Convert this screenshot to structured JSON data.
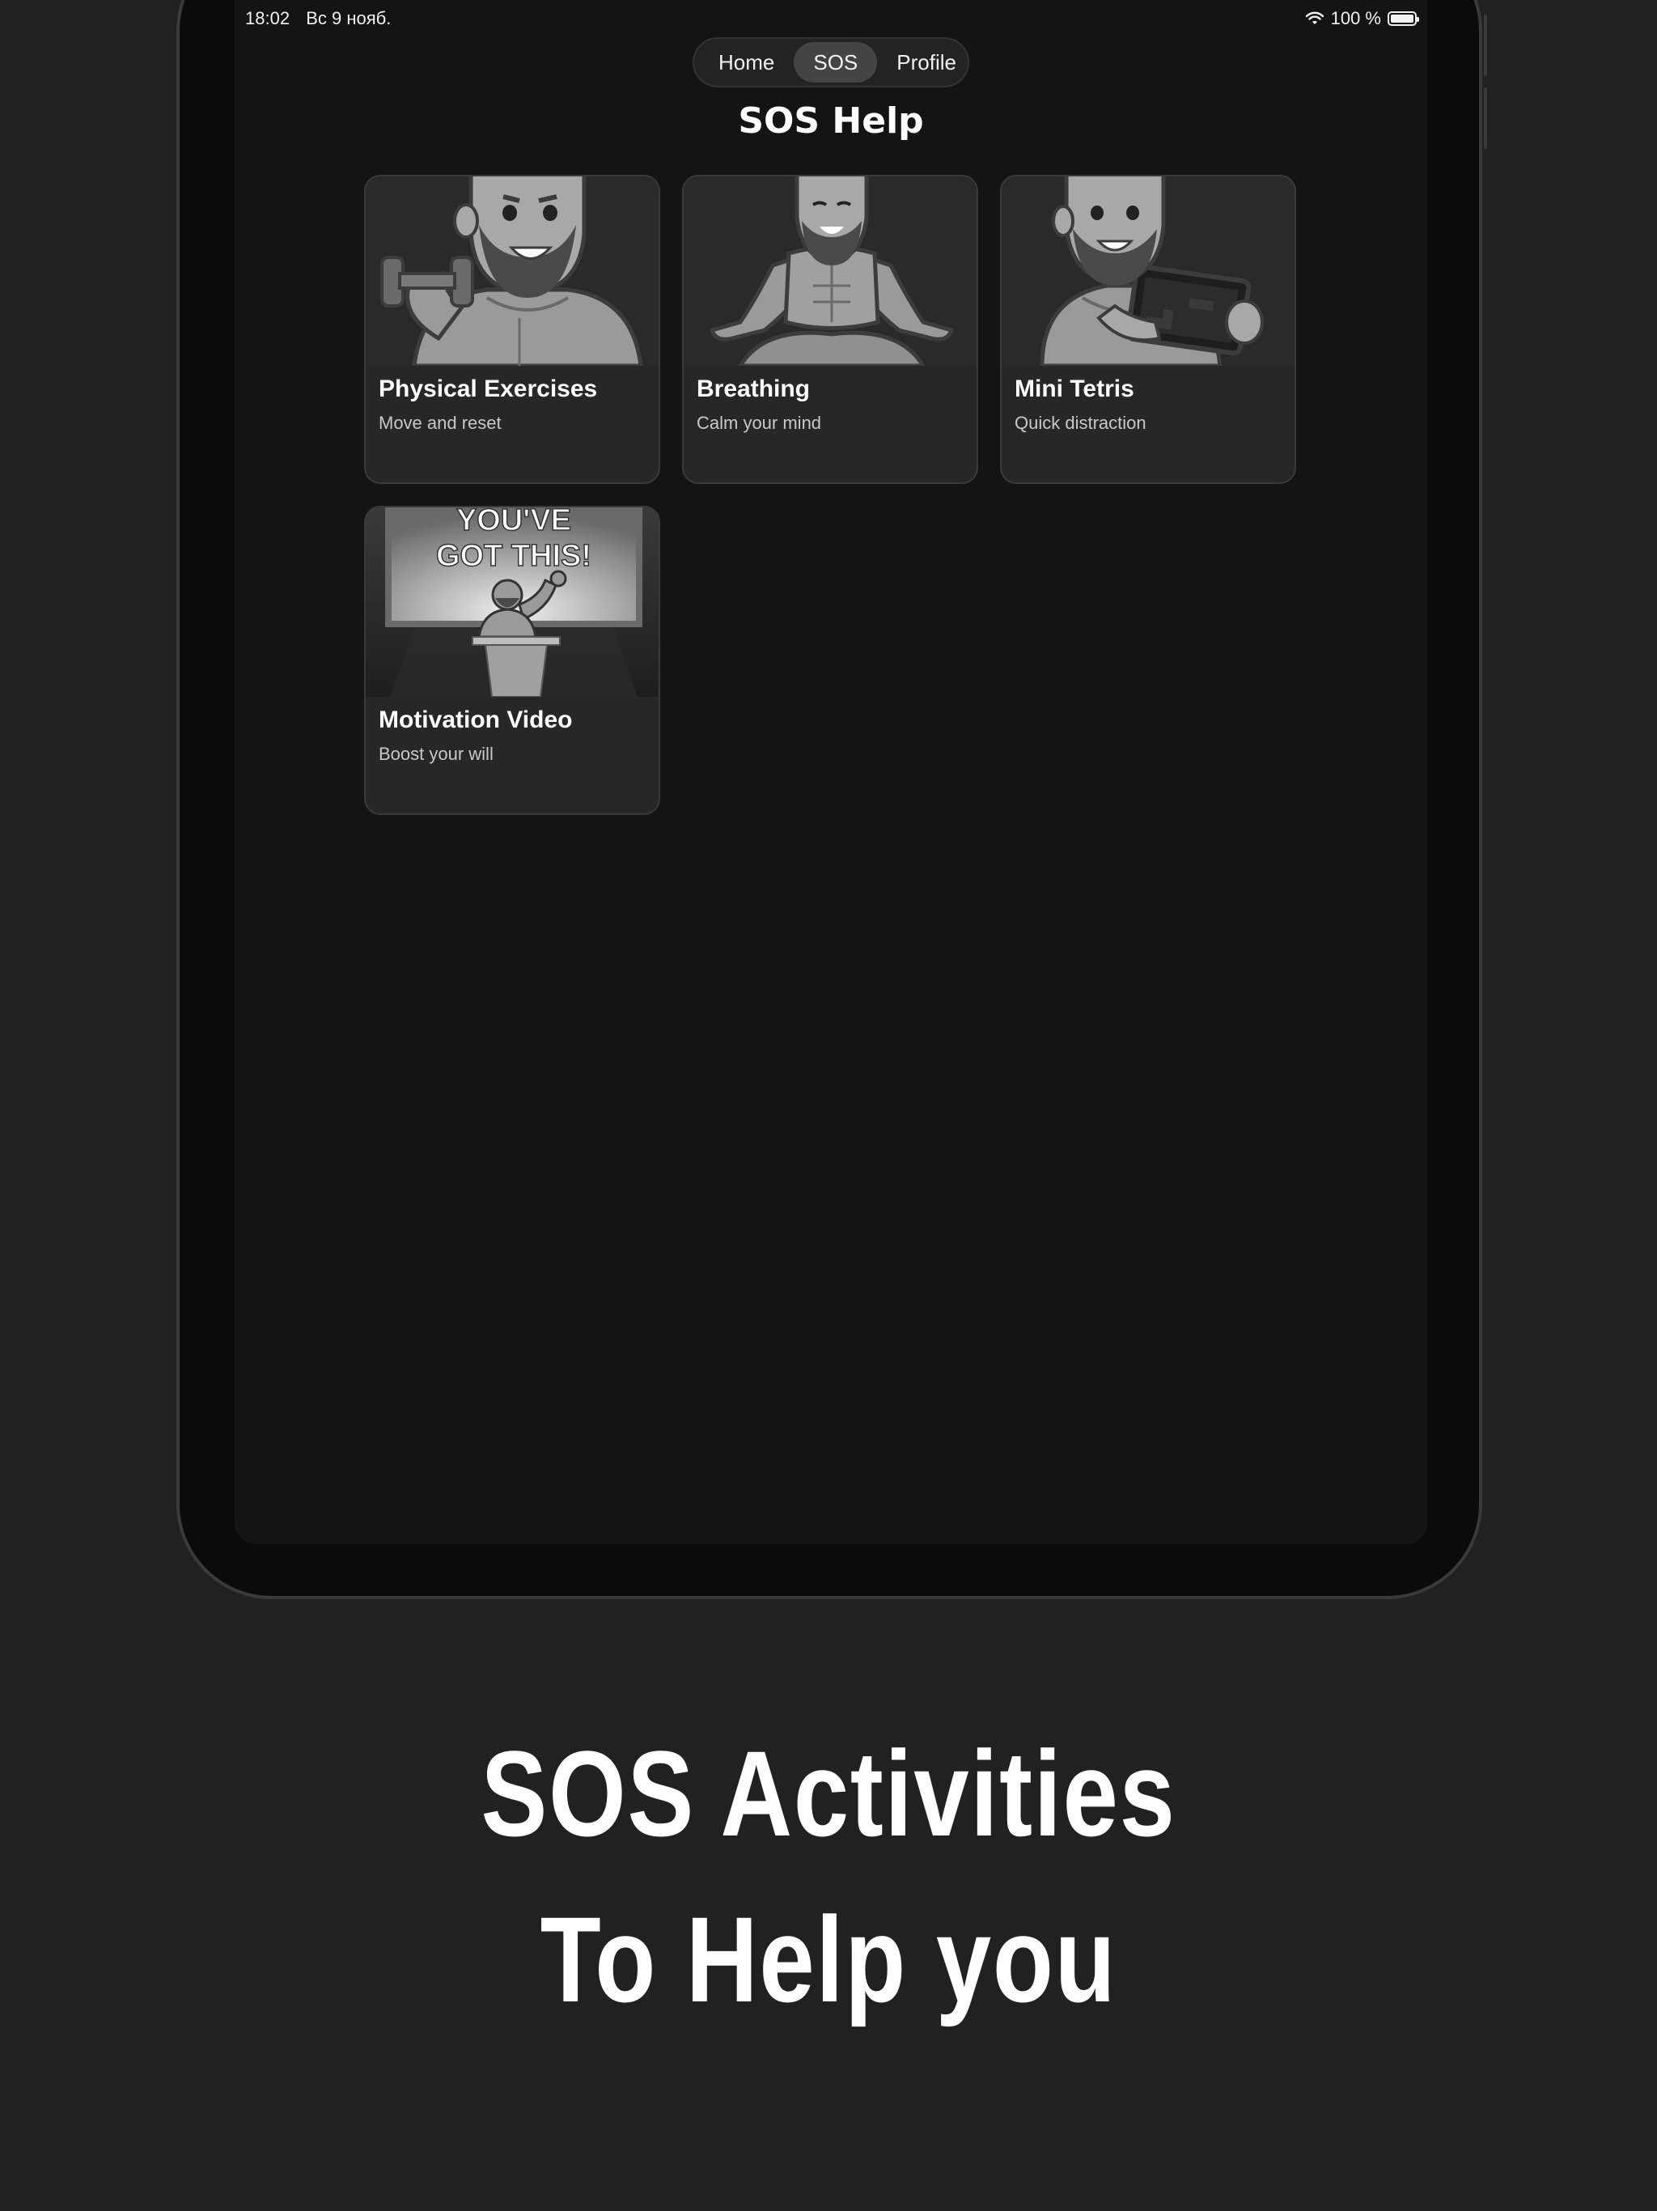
{
  "status_bar": {
    "time": "18:02",
    "date": "Вс 9 нояб.",
    "battery": "100 %"
  },
  "nav": {
    "tabs": [
      {
        "label": "Home"
      },
      {
        "label": "SOS"
      },
      {
        "label": "Profile"
      }
    ],
    "active": "SOS"
  },
  "page": {
    "title": "SOS Help"
  },
  "cards": [
    {
      "title": "Physical Exercises",
      "subtitle": "Move and reset",
      "icon": "muscleman-dumbbell-icon"
    },
    {
      "title": "Breathing",
      "subtitle": "Calm your mind",
      "icon": "muscleman-meditating-icon"
    },
    {
      "title": "Mini Tetris",
      "subtitle": "Quick distraction",
      "icon": "muscleman-tablet-icon"
    },
    {
      "title": "Motivation Video",
      "subtitle": "Boost your will",
      "icon": "motivation-screen-icon",
      "art_text": [
        "YOU'VE",
        "GOT THIS!"
      ]
    }
  ],
  "promo": {
    "line1": "SOS Activities",
    "line2": "To Help you"
  },
  "colors": {
    "background": "#212121",
    "screen": "#141414",
    "card": "#272727",
    "text": "#ffffff"
  }
}
